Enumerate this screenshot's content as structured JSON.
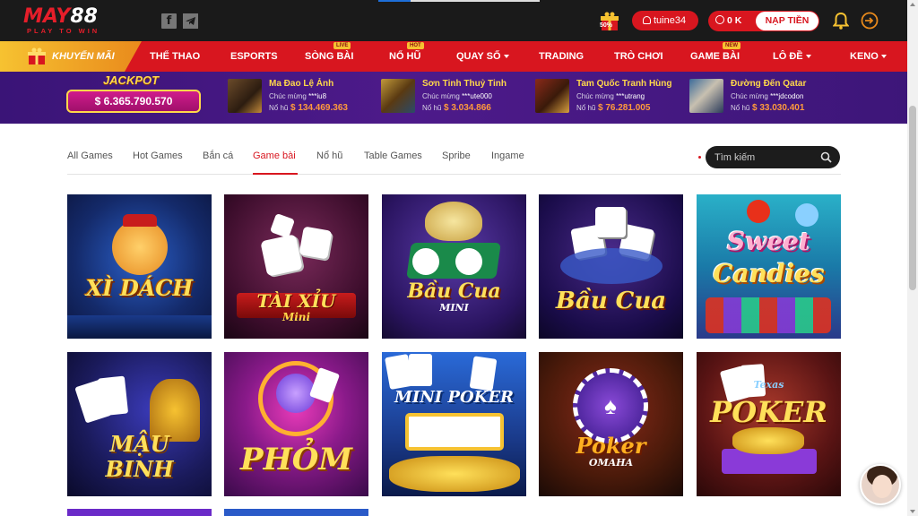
{
  "brand": {
    "logo_may": "MAY",
    "logo_88": "88",
    "tagline": "PLAY TO WIN"
  },
  "header": {
    "username": "tuine34",
    "balance": "0 K",
    "deposit_label": "NẠP TIỀN",
    "gift_badge": "50%"
  },
  "nav": {
    "promo_label": "KHUYẾN MÃI",
    "items": [
      {
        "label": "THỂ THAO"
      },
      {
        "label": "ESPORTS"
      },
      {
        "label": "SÒNG BÀI",
        "badge": "LIVE"
      },
      {
        "label": "NỔ HŨ",
        "badge": "HOT"
      },
      {
        "label": "QUAY SỐ"
      },
      {
        "label": "TRADING"
      },
      {
        "label": "TRÒ CHƠI"
      },
      {
        "label": "GAME BÀI",
        "badge": "NEW"
      },
      {
        "label": "LÔ ĐỀ"
      },
      {
        "label": "KENO"
      }
    ]
  },
  "jackpot": {
    "title": "JACKPOT",
    "value": "$ 6.365.790.570"
  },
  "winners": [
    {
      "game": "Ma Đao Lệ Ảnh",
      "congrats": "Chúc mừng",
      "user": "***iu8",
      "amount_label": "Nổ hũ",
      "amount": "$ 134.469.363"
    },
    {
      "game": "Sơn Tinh Thuỷ Tinh",
      "congrats": "Chúc mừng",
      "user": "***ute000",
      "amount_label": "Nổ hũ",
      "amount": "$ 3.034.866"
    },
    {
      "game": "Tam Quốc Tranh Hùng",
      "congrats": "Chúc mừng",
      "user": "***utrang",
      "amount_label": "Nổ hũ",
      "amount": "$ 76.281.005"
    },
    {
      "game": "Đường Đến Qatar",
      "congrats": "Chúc mừng",
      "user": "***jdcodon",
      "amount_label": "Nổ hũ",
      "amount": "$ 33.030.401"
    }
  ],
  "tabs": [
    {
      "label": "All Games"
    },
    {
      "label": "Hot Games"
    },
    {
      "label": "Bắn cá"
    },
    {
      "label": "Game bài",
      "active": true
    },
    {
      "label": "Nổ hũ"
    },
    {
      "label": "Table Games"
    },
    {
      "label": "Spribe"
    },
    {
      "label": "Ingame"
    }
  ],
  "search": {
    "placeholder": "Tìm kiếm"
  },
  "games": [
    {
      "title": "XÌ DÁCH",
      "subtitle": ""
    },
    {
      "title": "TÀI XỈU",
      "subtitle": "Mini"
    },
    {
      "title": "Bầu Cua",
      "subtitle": "MINI"
    },
    {
      "title": "Bầu Cua",
      "subtitle": ""
    },
    {
      "title": "Sweet",
      "subtitle": "Candies"
    },
    {
      "title": "MẬU",
      "subtitle": "BINH"
    },
    {
      "title": "PHỎM",
      "subtitle": ""
    },
    {
      "title": "MINI POKER",
      "subtitle": ""
    },
    {
      "title": "Poker",
      "subtitle": "OMAHA"
    },
    {
      "title": "POKER",
      "subtitle": "Texas"
    }
  ],
  "colors": {
    "brand_red": "#d8161f",
    "nav_red": "#d8161f",
    "gold": "#ffd84a",
    "jackpot_purple": "#4d1a8a",
    "topbar": "#1a1a1a"
  }
}
